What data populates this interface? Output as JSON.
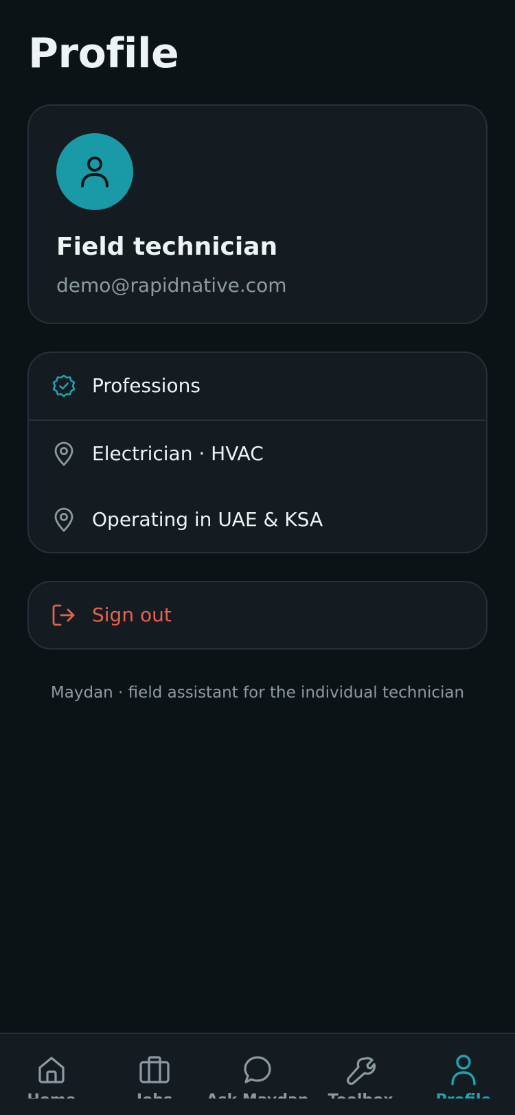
{
  "header": {
    "title": "Profile"
  },
  "profile": {
    "name": "Field technician",
    "email": "demo@rapidnative.com",
    "avatar_icon": "user-icon",
    "avatar_color": "#1a9aa6"
  },
  "info": {
    "professions_label": "Professions",
    "trades_label": "Electrician · HVAC",
    "region_label": "Operating in UAE & KSA",
    "professions_icon": "badge-check-icon",
    "location_icon": "map-pin-icon",
    "accent_color": "#1fa3af"
  },
  "signout": {
    "label": "Sign out",
    "icon": "log-out-icon",
    "color": "#e8604f"
  },
  "footer": {
    "note": "Maydan · field assistant for the individual technician"
  },
  "tabs": [
    {
      "label": "Home",
      "icon": "home-icon",
      "active": false
    },
    {
      "label": "Jobs",
      "icon": "briefcase-icon",
      "active": false
    },
    {
      "label": "Ask Maydan",
      "icon": "chat-bubble-icon",
      "active": false
    },
    {
      "label": "Toolbox",
      "icon": "wrench-icon",
      "active": false
    },
    {
      "label": "Profile",
      "icon": "user-icon",
      "active": true
    }
  ]
}
